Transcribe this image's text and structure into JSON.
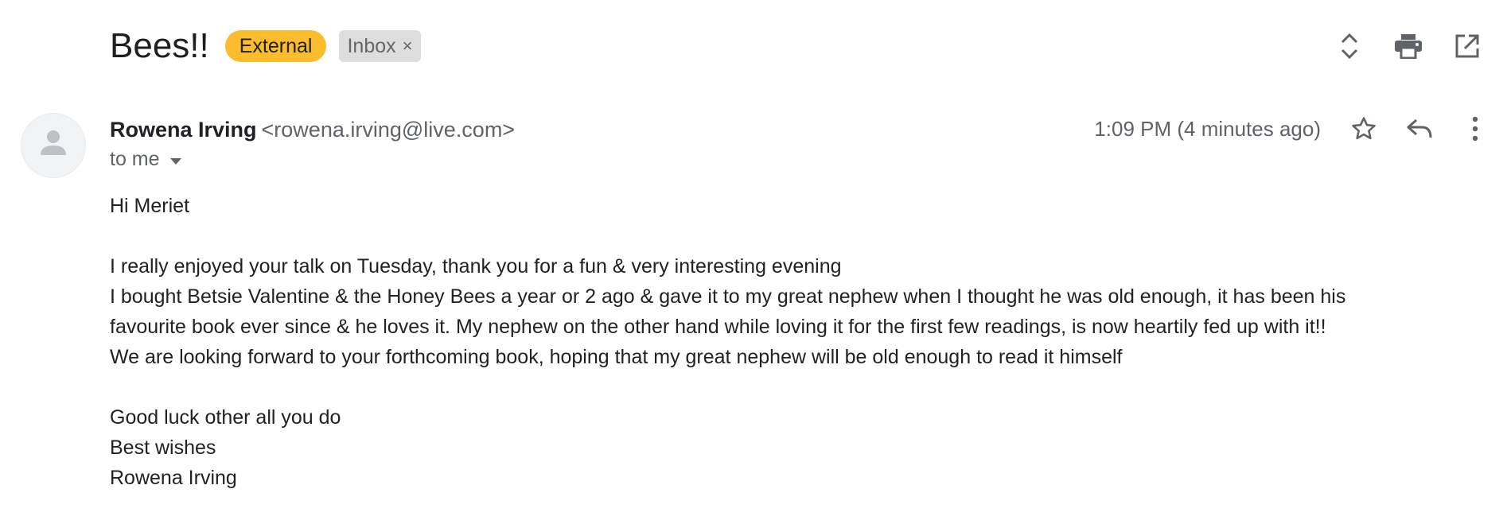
{
  "header": {
    "subject": "Bees!!",
    "labels": {
      "external": "External",
      "inbox": "Inbox",
      "inbox_remove": "×"
    },
    "icons": [
      "expand-collapse-icon",
      "print-icon",
      "open-in-new-window-icon"
    ]
  },
  "message": {
    "sender_name": "Rowena Irving",
    "sender_email": "<rowena.irving@live.com>",
    "recipient": "to me",
    "timestamp": "1:09 PM (4 minutes ago)",
    "action_icons": [
      "star-icon",
      "reply-icon",
      "more-vert-icon"
    ]
  },
  "body": {
    "greeting": "Hi Meriet",
    "para1": [
      "I really enjoyed your talk on Tuesday, thank you for a fun & very interesting evening",
      "I bought Betsie Valentine & the Honey Bees a year or 2 ago & gave it to my great nephew when I thought he was old enough,  it has been his",
      "favourite book ever since & he loves it. My nephew on the other hand while loving it for the first few readings, is now heartily fed up with it!!",
      "We are looking forward to your forthcoming book, hoping that my great nephew will be old enough to read it himself"
    ],
    "closing": [
      "Good luck other all you do",
      "Best wishes",
      "Rowena Irving"
    ]
  },
  "colors": {
    "external_label": "#fbbc2e",
    "inbox_label": "#dddddd",
    "icon": "#5f6368"
  }
}
